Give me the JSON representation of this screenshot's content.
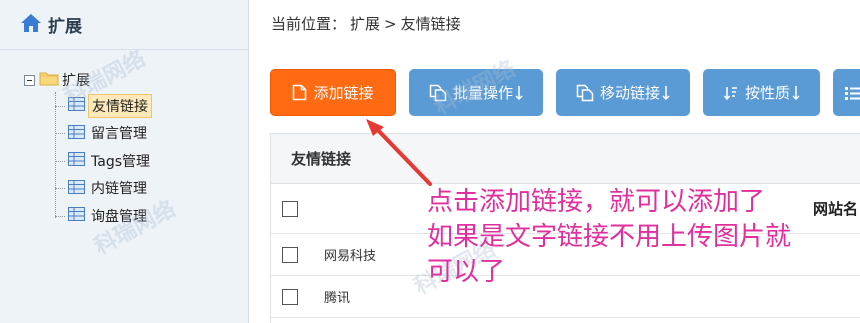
{
  "sidebar": {
    "title": "扩展",
    "root_label": "扩展",
    "items": [
      {
        "label": "友情链接",
        "active": true
      },
      {
        "label": "留言管理",
        "active": false
      },
      {
        "label": "Tags管理",
        "active": false
      },
      {
        "label": "内链管理",
        "active": false
      },
      {
        "label": "询盘管理",
        "active": false
      }
    ]
  },
  "breadcrumb": {
    "prefix": "当前位置：",
    "parent": "扩展",
    "separator": ">",
    "current": "友情链接"
  },
  "toolbar": {
    "add_label": "添加链接",
    "batch_label": "批量操作",
    "move_label": "移动链接",
    "nature_label": "按性质"
  },
  "panel": {
    "title": "友情链接",
    "column_header": "网站名",
    "rows": [
      {
        "name": "网易科技"
      },
      {
        "name": "腾讯"
      }
    ]
  },
  "annotation": {
    "line1": "点击添加链接，就可以添加了",
    "line2": "如果是文字链接不用上传图片就",
    "line3": "可以了"
  },
  "watermark": "科瑞网络",
  "colors": {
    "add_button": "#ff6a13",
    "secondary_button": "#5b9bd5",
    "annotation": "#e0309e",
    "arrow": "#e53935"
  }
}
